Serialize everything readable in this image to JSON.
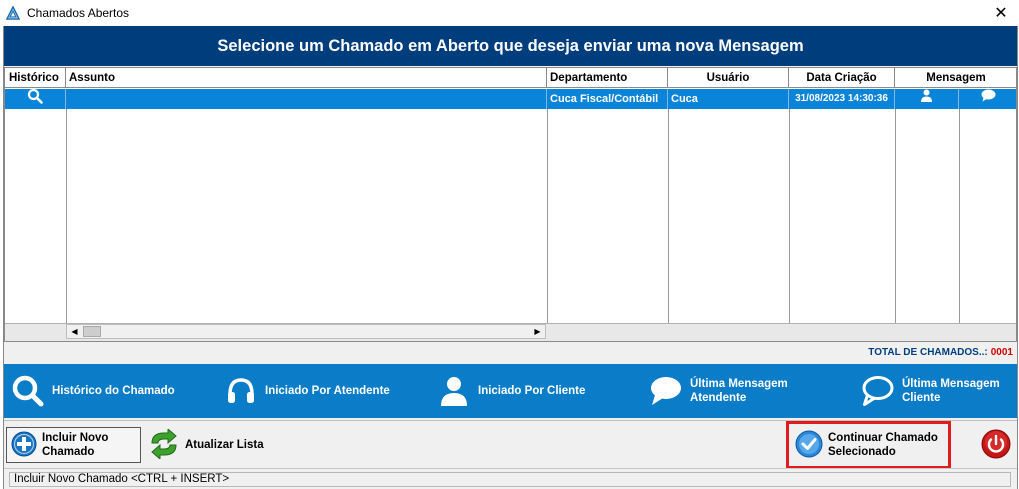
{
  "window": {
    "title": "Chamados Abertos",
    "close_glyph": "✕",
    "app_icon": "triangle-logo-icon"
  },
  "banner": {
    "text": "Selecione um Chamado em Aberto que deseja enviar uma nova Mensagem"
  },
  "grid": {
    "columns": [
      "Histórico",
      "Assunto",
      "Departamento",
      "Usuário",
      "Data Criação",
      "Mensagem"
    ],
    "rows": [
      {
        "historico_icon": "search-icon",
        "assunto": "",
        "departamento": "Cuca Fiscal/Contábil",
        "usuario": "Cuca",
        "data_criacao": "31/08/2023 14:30:36",
        "mensagem_icons": [
          "person-icon",
          "chat-bubble-icon"
        ]
      }
    ],
    "selected_row_color": "#0a84d8"
  },
  "total": {
    "label": "TOTAL DE CHAMADOS..:",
    "value": "0001"
  },
  "legend": {
    "items": [
      {
        "icon": "search-icon",
        "label": "Histórico do Chamado"
      },
      {
        "icon": "headset-icon",
        "label": "Iniciado Por Atendente"
      },
      {
        "icon": "person-icon",
        "label": "Iniciado Por Cliente"
      },
      {
        "icon": "chat-bubble-filled-icon",
        "label": "Última Mensagem\nAtendente"
      },
      {
        "icon": "chat-bubble-outline-icon",
        "label": "Última Mensagem\nCliente"
      }
    ],
    "background": "#0a7cc8"
  },
  "toolbar": {
    "new_label": "Incluir Novo\nChamado",
    "refresh_label": "Atualizar Lista",
    "continue_label": "Continuar Chamado\nSelecionado",
    "exit_icon": "power-icon"
  },
  "statusbar": {
    "text": "Incluir Novo Chamado  <CTRL + INSERT>"
  },
  "colors": {
    "banner": "#003d7d",
    "highlight_border": "#e01c1c",
    "total_count": "#d00000"
  }
}
